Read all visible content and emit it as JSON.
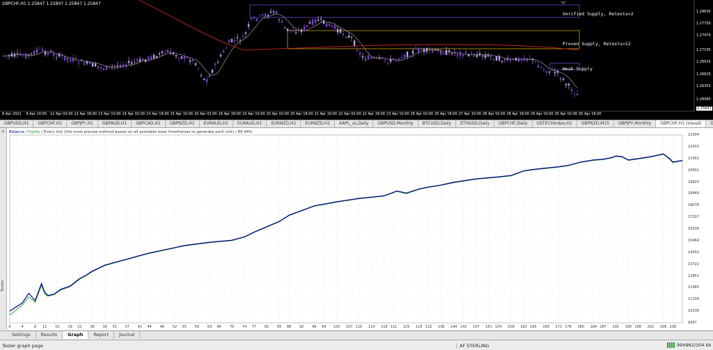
{
  "chart": {
    "header": "GBPCHF,H1  1.25847 1.25847 1.25847 1.25847",
    "price_ticks": [
      "1.28830",
      "1.27750",
      "1.27470",
      "1.27195",
      "1.26915",
      "1.26625",
      "1.26355",
      "1.26080",
      "1.25847"
    ],
    "current_price": "1.25847",
    "time_ticks": [
      "8 Apr 2021",
      "9 Apr 10:00",
      "12 Apr 02:00",
      "12 Apr 18:00",
      "13 Apr 10:00",
      "14 Apr 02:00",
      "14 Apr 18:00",
      "15 Apr 10:00",
      "16 Apr 02:00",
      "16 Apr 18:00",
      "19 Apr 10:00",
      "20 Apr 02:00",
      "20 Apr 18:00",
      "21 Apr 10:00",
      "22 Apr 02:00",
      "22 Apr 18:00",
      "23 Apr 10:00",
      "26 Apr 02:00",
      "26 Apr 18:00",
      "27 Apr 10:00",
      "28 Apr 02:00",
      "28 Apr 18:00",
      "29 Apr 10:00",
      "30 Apr 02:00",
      "30 Apr 18:00"
    ],
    "zones": [
      {
        "label": "Verified Supply, Retests=2",
        "color": "#5a4fcf"
      },
      {
        "label": "Proven Supply, Retests=12",
        "color": "#d4a017"
      },
      {
        "label": "Weak Supply",
        "color": "#5a4fcf"
      }
    ],
    "colors": {
      "bull_candle": "#b7a3e8",
      "bear_candle": "#7b3fc7",
      "ma_red": "#c8281e",
      "ma_grey": "#9a9a9a"
    }
  },
  "chart_tabs": [
    "GBPUSD,H1",
    "GBPCHF,H1",
    "GBPJPY,H1",
    "GBPAUD,H1",
    "GBPCAD,H1",
    "GBPNZD,H1",
    "EURAUD,H1",
    "EURAUD,H1",
    "EURNZD,H1",
    "EURNZD,H1",
    "AAPL_us,Daily",
    "GBPUSD,Monthly",
    "BTCUSD,Daily",
    "ETHUSD,Daily",
    "GBPCHF,Daily",
    "USTECHIndex,H1",
    "GBPNZD,M15",
    "GBPJPY,Monthly",
    "GBPCHF,H1 (visual)",
    "GBPCHF,H1 -"
  ],
  "active_chart_tab": 18,
  "graph": {
    "legend_balance": "Balance",
    "legend_separator": "/",
    "legend_equity": "Equity",
    "legend_text": "/ Every tick (the most precise method based on all available least timeframes to generate each tick) / 89.94%",
    "y_ticks": [
      "22304",
      "22433",
      "21562",
      "20691",
      "19820",
      "18949",
      "18078",
      "17207",
      "16336",
      "15464",
      "14593",
      "13722",
      "12851",
      "11980",
      "11109",
      "10238",
      "9367"
    ],
    "x_ticks": [
      "0",
      "4",
      "8",
      "11",
      "15",
      "19",
      "22",
      "26",
      "30",
      "33",
      "37",
      "41",
      "44",
      "48",
      "52",
      "55",
      "59",
      "63",
      "66",
      "70",
      "74",
      "77",
      "81",
      "85",
      "88",
      "92",
      "96",
      "99",
      "103",
      "107",
      "110",
      "114",
      "118",
      "121",
      "125",
      "129",
      "132",
      "136",
      "140",
      "143",
      "147",
      "151",
      "154",
      "158",
      "162",
      "165",
      "169",
      "173",
      "176",
      "180",
      "184",
      "187",
      "191",
      "195",
      "198",
      "202",
      "206",
      "209"
    ],
    "colors": {
      "balance": "#00008b",
      "equity": "#3cb043",
      "grid": "#d0d0d0"
    },
    "side_label": "Tester"
  },
  "chart_data": {
    "type": "line",
    "xlabel": "",
    "ylabel": "",
    "xlim": [
      0,
      212
    ],
    "ylim": [
      9367,
      23304
    ],
    "series": [
      {
        "name": "Balance",
        "x": [
          0,
          4,
          6,
          8,
          10,
          11,
          12,
          14,
          16,
          19,
          22,
          24,
          26,
          30,
          33,
          37,
          40,
          44,
          48,
          55,
          63,
          70,
          74,
          77,
          81,
          85,
          88,
          92,
          96,
          103,
          110,
          118,
          122,
          125,
          129,
          132,
          136,
          140,
          147,
          154,
          158,
          162,
          165,
          169,
          173,
          176,
          180,
          184,
          187,
          190,
          191,
          193,
          195,
          198,
          202,
          206,
          208,
          209,
          212
        ],
        "y": [
          10238,
          10850,
          11560,
          11020,
          12290,
          11650,
          11400,
          11500,
          11850,
          12100,
          12650,
          12900,
          13200,
          13650,
          13850,
          14100,
          14300,
          14550,
          14750,
          15100,
          15350,
          15500,
          15750,
          16100,
          16500,
          16900,
          17350,
          17700,
          18050,
          18350,
          18600,
          18800,
          19150,
          19000,
          19300,
          19450,
          19600,
          19800,
          20050,
          20200,
          20300,
          20650,
          20750,
          20850,
          20950,
          21050,
          21300,
          21450,
          21500,
          21650,
          21750,
          21700,
          21450,
          21550,
          21700,
          21900,
          21550,
          21300,
          21420
        ]
      },
      {
        "name": "Equity",
        "x": [
          0,
          4,
          6,
          8,
          10,
          11,
          12,
          14,
          16,
          19,
          22,
          24,
          26,
          30,
          33,
          37,
          40,
          44,
          48,
          55,
          63,
          70,
          74,
          77,
          81,
          85,
          88,
          92,
          96,
          103,
          110,
          118,
          122,
          125,
          129,
          132,
          136,
          140,
          147,
          154,
          158,
          162,
          165,
          169,
          173,
          176,
          180,
          184,
          187,
          190,
          191,
          193,
          195,
          198,
          202,
          206,
          208,
          209,
          212
        ],
        "y": [
          9950,
          10700,
          11300,
          10900,
          12150,
          11520,
          11350,
          11460,
          11790,
          12050,
          12600,
          12860,
          13160,
          13620,
          13810,
          14070,
          14270,
          14520,
          14720,
          15070,
          15320,
          15470,
          15720,
          16070,
          16470,
          16870,
          17320,
          17670,
          18020,
          18320,
          18570,
          18770,
          19120,
          18950,
          19270,
          19420,
          19570,
          19770,
          20020,
          20170,
          20270,
          20620,
          20720,
          20820,
          20920,
          21020,
          21270,
          21420,
          21470,
          21620,
          21720,
          21670,
          21420,
          21520,
          21670,
          21870,
          21500,
          21250,
          21400
        ]
      }
    ]
  },
  "tester_tabs": [
    "Settings",
    "Results",
    "Graph",
    "Report",
    "Journal"
  ],
  "active_tester_tab": 2,
  "status": {
    "left": "Tester graph page",
    "profile": "AF STERLING",
    "connection": "994982/304 kb"
  }
}
